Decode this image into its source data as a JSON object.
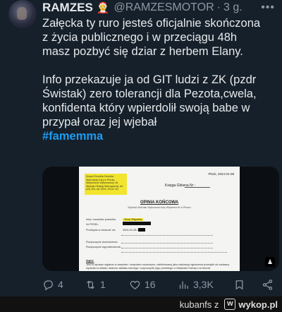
{
  "tweet": {
    "author": {
      "name": "RAMZES",
      "badge": "🤶",
      "handle": "@RAMZESMOTOR",
      "time": "3 g."
    },
    "more_icon": "more-dots-icon",
    "text_lines": [
      "Załęcka ty ruro jesteś oficjalnie skończona",
      "z życia publicznego i w przeciągu 48h",
      "masz pozbyć się dziar z herbem Elany.",
      "Info przekazuje ja od GIT ludzi z ZK (pzdr",
      "Świstak) zero tolerancji dla Pezota,cwela,",
      "konfidenta który wpierdolił swoją babe w",
      "przypał oraz jej wjebał"
    ],
    "hashtag": "#famemma",
    "media": {
      "doc_place": "Płock, 2024-01-08",
      "stamp_text": "Zespół Ośrodka Ośrodka Wykonania Kary w Płocku, Wojewódzki Wykonawczy 18, Wydział Obsługi Wewnętrznej, tel. (24) 333, fax 3224, 22412 111",
      "ledger_label": "Księga Główna Nr :",
      "heading": "OPINIA KOŃCOWA",
      "sub": "Wydział Oddziału Wykonania Kary Więzienia Nr w Płocku",
      "rows": [
        {
          "label": "Imię i nazwisko prawnika",
          "value": "Jerzy Zbigniew"
        },
        {
          "label": "Nr PESEL:",
          "value": ""
        },
        {
          "label": "Przebywa w areszcie od:",
          "value": "2024-01-05 do"
        },
        {
          "label": "Rozpoczęcie dochodzenia:",
          "value": ""
        },
        {
          "label": "Rozpoczęcie wypowiedzenia:",
          "value": ""
        }
      ],
      "section": "Opis:",
      "para": "Jest to sprawa najpierw w zasadzie i zespołem osobowym, zdefiniowany jako realizacja zgłoszenia przesyłki od nadawcy wydziału w składu nadzoru zakładu karnego i rozpoczęcie jego przebiegu w Zakładzie Karnym na terenie",
      "gif_icon": "person-silhouette-icon"
    },
    "actions": {
      "reply": {
        "icon": "reply-icon",
        "count": "4"
      },
      "retweet": {
        "icon": "retweet-icon",
        "count": "1"
      },
      "like": {
        "icon": "heart-icon",
        "count": "16"
      },
      "views": {
        "icon": "views-icon",
        "count": "3,3K"
      },
      "bookmark": {
        "icon": "bookmark-icon",
        "count": ""
      },
      "share": {
        "icon": "share-icon",
        "count": ""
      }
    }
  },
  "footer": {
    "user": "kubanfs",
    "connector": "z",
    "logo_letter": "w",
    "site": "wykop.pl"
  }
}
